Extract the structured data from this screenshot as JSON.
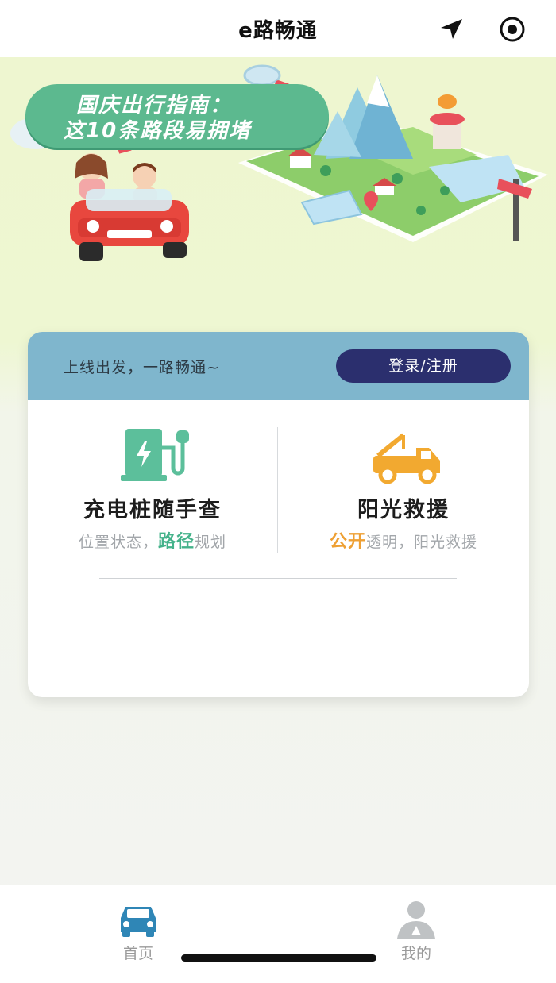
{
  "nav": {
    "title": "e路畅通",
    "location_icon": "navigation-arrow-icon",
    "record_icon": "target-circle-icon"
  },
  "banner": {
    "title_line1": "国庆出行指南：",
    "title_line2": "这10条路段易拥堵",
    "illustration": "couple-car-map-illustration"
  },
  "card": {
    "slogan": "上线出发，一路畅通~",
    "login_label": "登录/注册",
    "services": [
      {
        "icon": "charging-station-icon",
        "title": "充电桩随手查",
        "desc_before": "位置状态，",
        "desc_highlight": "路径",
        "desc_after": "规划",
        "accent": "#44b28a"
      },
      {
        "icon": "tow-truck-icon",
        "title": "阳光救援",
        "desc_before": "",
        "desc_highlight": "公开",
        "desc_after": "透明，阳光救援",
        "accent": "#eea034"
      }
    ]
  },
  "tabbar": {
    "tabs": [
      {
        "label": "首页",
        "icon": "car-icon",
        "active": true
      },
      {
        "label": "我的",
        "icon": "user-icon",
        "active": false
      }
    ]
  },
  "colors": {
    "header_strip": "#7fb6cd",
    "login_button": "#2b2f6e",
    "banner_bubble": "#5cb98f",
    "tab_active": "#2f86b6"
  }
}
